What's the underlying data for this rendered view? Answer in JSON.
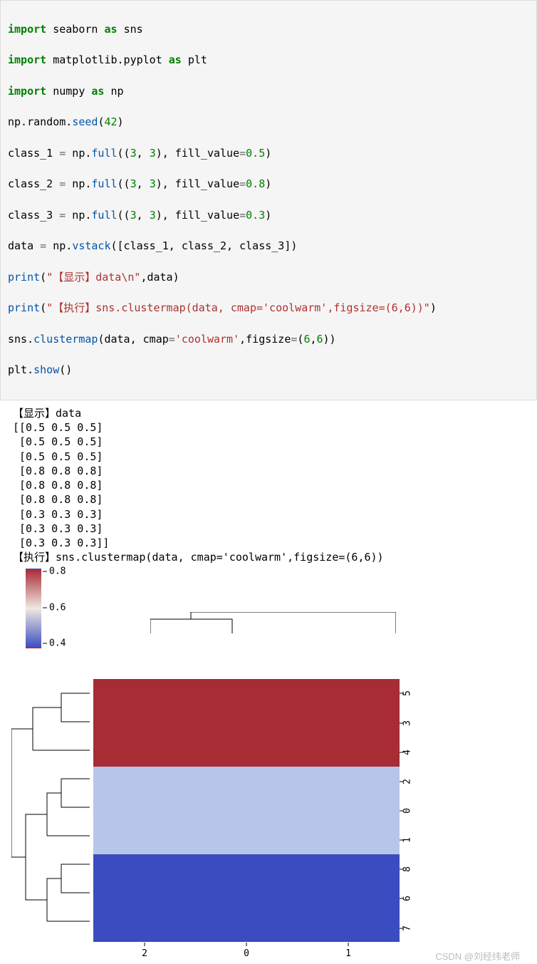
{
  "code": {
    "l1": {
      "a": "import",
      "b": "seaborn",
      "c": "as",
      "d": "sns"
    },
    "l2": {
      "a": "import",
      "b": "matplotlib.pyplot",
      "c": "as",
      "d": "plt"
    },
    "l3": {
      "a": "import",
      "b": "numpy",
      "c": "as",
      "d": "np"
    },
    "l4": {
      "a": "np.",
      "b": "random",
      "c": ".",
      "d": "seed",
      "e": "(",
      "f": "42",
      "g": ")"
    },
    "l5": {
      "a": "class_1 ",
      "b": "=",
      "c": " np.",
      "d": "full",
      "e": "((",
      "f": "3",
      "g": ", ",
      "h": "3",
      "i": "), fill_value",
      "j": "=",
      "k": "0.5",
      "l": ")"
    },
    "l6": {
      "a": "class_2 ",
      "b": "=",
      "c": " np.",
      "d": "full",
      "e": "((",
      "f": "3",
      "g": ", ",
      "h": "3",
      "i": "), fill_value",
      "j": "=",
      "k": "0.8",
      "l": ")"
    },
    "l7": {
      "a": "class_3 ",
      "b": "=",
      "c": " np.",
      "d": "full",
      "e": "((",
      "f": "3",
      "g": ", ",
      "h": "3",
      "i": "), fill_value",
      "j": "=",
      "k": "0.3",
      "l": ")"
    },
    "l8": {
      "a": "data ",
      "b": "=",
      "c": " np.",
      "d": "vstack",
      "e": "([class_1, class_2, class_3])"
    },
    "l9": {
      "a": "print",
      "b": "(",
      "c": "\"【显示】data\\n\"",
      "d": ",data)"
    },
    "l10": {
      "a": "print",
      "b": "(",
      "c": "\"【执行】sns.clustermap(data, cmap='coolwarm',figsize=(6,6))\"",
      "d": ")"
    },
    "l11": {
      "a": "sns.",
      "b": "clustermap",
      "c": "(data, cmap",
      "d": "=",
      "e": "'coolwarm'",
      "f": ",figsize",
      "g": "=",
      "h": "(",
      "i": "6",
      "j": ",",
      "k": "6",
      "l": "))"
    },
    "l12": {
      "a": "plt.",
      "b": "show",
      "c": "()"
    }
  },
  "output": "【显示】data\n[[0.5 0.5 0.5]\n [0.5 0.5 0.5]\n [0.5 0.5 0.5]\n [0.8 0.8 0.8]\n [0.8 0.8 0.8]\n [0.8 0.8 0.8]\n [0.3 0.3 0.3]\n [0.3 0.3 0.3]\n [0.3 0.3 0.3]]\n【执行】sns.clustermap(data, cmap='coolwarm',figsize=(6,6))",
  "cbar_ticks": {
    "t0": "0.8",
    "t1": "0.6",
    "t2": "0.4"
  },
  "xticks": {
    "x0": "2",
    "x1": "0",
    "x2": "1"
  },
  "yticks": {
    "y0": "5",
    "y1": "3",
    "y2": "4",
    "y3": "2",
    "y4": "0",
    "y5": "1",
    "y6": "8",
    "y7": "6",
    "y8": "7"
  },
  "watermark": "CSDN @刘经纬老师",
  "chart_data": {
    "type": "heatmap",
    "row_order": [
      5,
      3,
      4,
      2,
      0,
      1,
      8,
      6,
      7
    ],
    "col_order": [
      2,
      0,
      1
    ],
    "matrix": [
      [
        0.8,
        0.8,
        0.8
      ],
      [
        0.8,
        0.8,
        0.8
      ],
      [
        0.8,
        0.8,
        0.8
      ],
      [
        0.5,
        0.5,
        0.5
      ],
      [
        0.5,
        0.5,
        0.5
      ],
      [
        0.5,
        0.5,
        0.5
      ],
      [
        0.3,
        0.3,
        0.3
      ],
      [
        0.3,
        0.3,
        0.3
      ],
      [
        0.3,
        0.3,
        0.3
      ]
    ],
    "cmap": "coolwarm",
    "vmin": 0.3,
    "vmax": 0.8,
    "figsize": [
      6,
      6
    ],
    "colorbar_ticks": [
      0.4,
      0.6,
      0.8
    ]
  }
}
